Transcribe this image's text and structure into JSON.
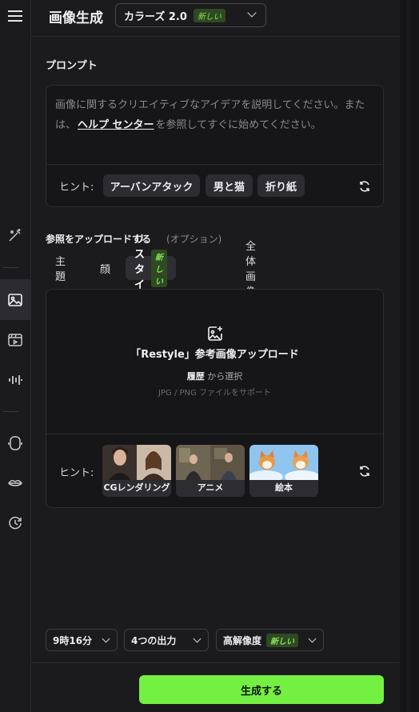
{
  "header": {
    "title": "画像生成",
    "model": {
      "name": "カラーズ 2.0",
      "badge": "新しい"
    }
  },
  "prompt": {
    "label": "プロンプト",
    "placeholder_before": "画像に関するクリエイティブなアイデアを説明してください。または、",
    "link": "ヘルプ センター",
    "placeholder_after": "を参照してすぐに始めてください。",
    "hint_label": "ヒント:",
    "chips": [
      "アーバンアタック",
      "男と猫",
      "折り紙"
    ]
  },
  "reference": {
    "label": "参照をアップロードする",
    "optional": "(オプション)",
    "tabs": [
      {
        "label": "主題"
      },
      {
        "label": "顔"
      },
      {
        "label": "リスタイル",
        "badge": "新しい",
        "selected": true
      },
      {
        "label": "全体画像"
      }
    ],
    "upload_title": "「Restyle」参考画像アップロード",
    "history_link": "履歴",
    "select_text": "から選択",
    "formats": "JPG / PNG ファイルをサポート",
    "hint_label": "ヒント:",
    "styles": [
      "CGレンダリング",
      "アニメ",
      "絵本"
    ]
  },
  "options": {
    "duration": "9時16分",
    "outputs": "4つの出力",
    "resolution": "高解像度",
    "resolution_badge": "新しい"
  },
  "generate_button": "生成する",
  "colors": {
    "accent": "#74f042",
    "badge_bg": "#2e4a22",
    "badge_text": "#8be05a"
  },
  "rail_icons": [
    "menu-icon",
    "magic-wand-icon",
    "image-icon",
    "video-icon",
    "audio-wave-icon",
    "avatar-icon",
    "lips-icon",
    "history-icon"
  ]
}
